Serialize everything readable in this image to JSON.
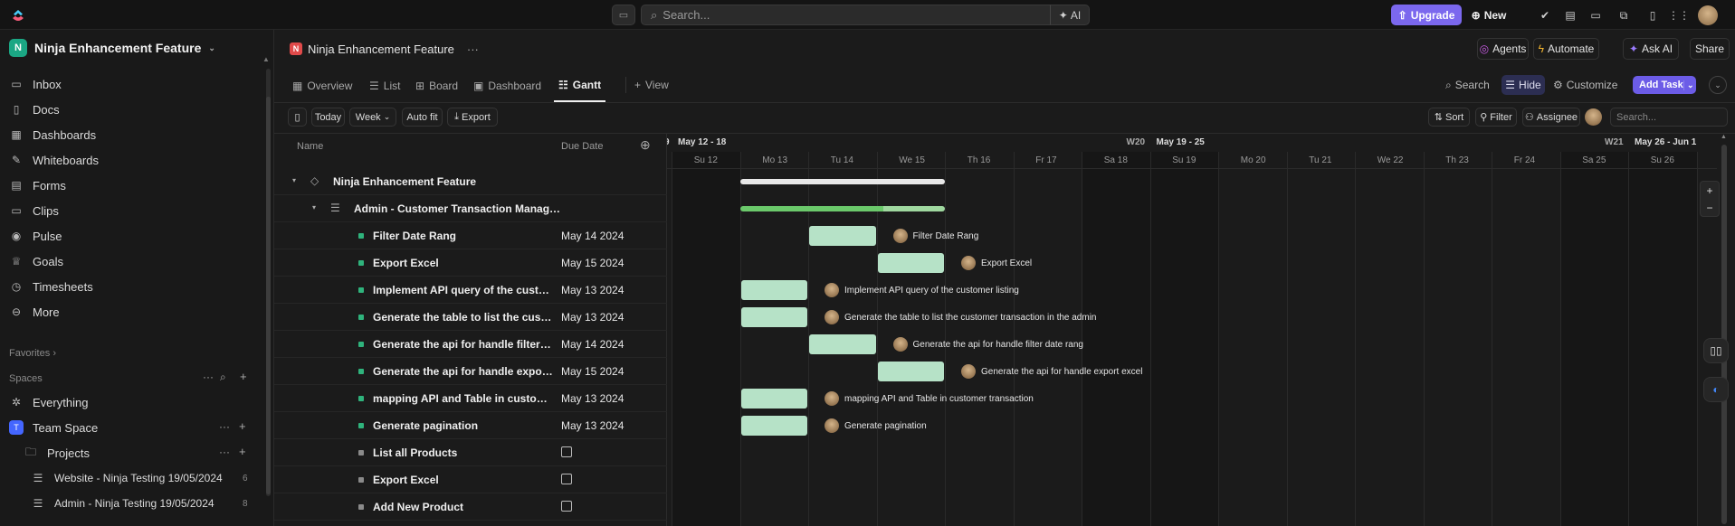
{
  "topbar": {
    "search_placeholder": "Search...",
    "ai_label": "AI",
    "upgrade_label": "Upgrade",
    "new_label": "New"
  },
  "sidebar": {
    "workspace_badge": "N",
    "workspace_name": "Ninja Enhancement Feature",
    "items": [
      {
        "label": "Inbox",
        "icon": "inbox-icon"
      },
      {
        "label": "Docs",
        "icon": "docs-icon"
      },
      {
        "label": "Dashboards",
        "icon": "dashboards-icon"
      },
      {
        "label": "Whiteboards",
        "icon": "whiteboards-icon"
      },
      {
        "label": "Forms",
        "icon": "forms-icon"
      },
      {
        "label": "Clips",
        "icon": "clips-icon"
      },
      {
        "label": "Pulse",
        "icon": "pulse-icon"
      },
      {
        "label": "Goals",
        "icon": "goals-icon"
      },
      {
        "label": "Timesheets",
        "icon": "timesheets-icon"
      },
      {
        "label": "More",
        "icon": "more-icon"
      }
    ],
    "favorites_label": "Favorites",
    "spaces_label": "Spaces",
    "everything_label": "Everything",
    "team_space_label": "Team Space",
    "team_space_badge": "T",
    "projects_label": "Projects",
    "lists": [
      {
        "label": "Website - Ninja Testing 19/05/2024",
        "count": "6"
      },
      {
        "label": "Admin - Ninja Testing 19/05/2024",
        "count": "8"
      }
    ]
  },
  "header": {
    "crumb_badge": "N",
    "crumb_title": "Ninja Enhancement Feature",
    "more": "···",
    "agents_label": "Agents",
    "automate_label": "Automate",
    "ask_ai_label": "Ask AI",
    "share_label": "Share"
  },
  "views": {
    "tabs": [
      {
        "label": "Overview"
      },
      {
        "label": "List"
      },
      {
        "label": "Board"
      },
      {
        "label": "Dashboard"
      },
      {
        "label": "Gantt"
      }
    ],
    "add_view_label": "View",
    "search_label": "Search",
    "hide_label": "Hide",
    "customize_label": "Customize",
    "add_task_label": "Add Task"
  },
  "toolbar": {
    "today_label": "Today",
    "week_label": "Week",
    "autofit_label": "Auto fit",
    "export_label": "Export",
    "sort_label": "Sort",
    "filter_label": "Filter",
    "assignee_label": "Assignee",
    "search_placeholder": "Search..."
  },
  "list": {
    "col_name": "Name",
    "col_due": "Due Date",
    "folder_name": "Ninja Enhancement Feature",
    "list_name": "Admin - Customer Transaction Manage...",
    "tasks": [
      {
        "name": "Filter Date Rang",
        "due": "May 14 2024",
        "status_color": "#2fb37c"
      },
      {
        "name": "Export Excel",
        "due": "May 15 2024",
        "status_color": "#2fb37c"
      },
      {
        "name": "Implement API query of the custo...",
        "due": "May 13 2024",
        "status_color": "#2fb37c"
      },
      {
        "name": "Generate the table to list the custo...",
        "due": "May 13 2024",
        "status_color": "#2fb37c"
      },
      {
        "name": "Generate the api for handle filter d...",
        "due": "May 14 2024",
        "status_color": "#2fb37c"
      },
      {
        "name": "Generate the api for handle export ...",
        "due": "May 15 2024",
        "status_color": "#2fb37c"
      },
      {
        "name": "mapping API and Table in custome...",
        "due": "May 13 2024",
        "status_color": "#2fb37c"
      },
      {
        "name": "Generate pagination",
        "due": "May 13 2024",
        "status_color": "#2fb37c"
      },
      {
        "name": "List all Products",
        "due": "",
        "status_color": "#8a8a8a"
      },
      {
        "name": "Export Excel",
        "due": "",
        "status_color": "#8a8a8a"
      },
      {
        "name": "Add New Product",
        "due": "",
        "status_color": "#8a8a8a"
      }
    ]
  },
  "gantt": {
    "weeks": [
      {
        "label": "May 12 - 18",
        "week_no": "W20"
      },
      {
        "label": "May 19 - 25",
        "week_no": "W21"
      },
      {
        "label": "May 26 - Jun 1",
        "week_no": ""
      }
    ],
    "partial_prev_label": "9",
    "days": [
      "Su 12",
      "Mo 13",
      "Tu 14",
      "We 15",
      "Th 16",
      "Fr 17",
      "Sa 18",
      "Su 19",
      "Mo 20",
      "Tu 21",
      "We 22",
      "Th 23",
      "Fr 24",
      "Sa 25",
      "Su 26",
      "M"
    ],
    "bar_labels": [
      "Filter Date Rang",
      "Export Excel",
      "Implement API query of the customer listing",
      "Generate the table to list the customer transaction in the admin",
      "Generate the api for handle filter date rang",
      "Generate the api for handle export excel",
      "mapping API and Table in customer transaction",
      "Generate pagination"
    ],
    "zoom_in": "+",
    "zoom_out": "−"
  },
  "colors": {
    "accent": "#7b68ee",
    "bar_green": "#b6e2c7",
    "progress_green": "#6bc96b"
  }
}
